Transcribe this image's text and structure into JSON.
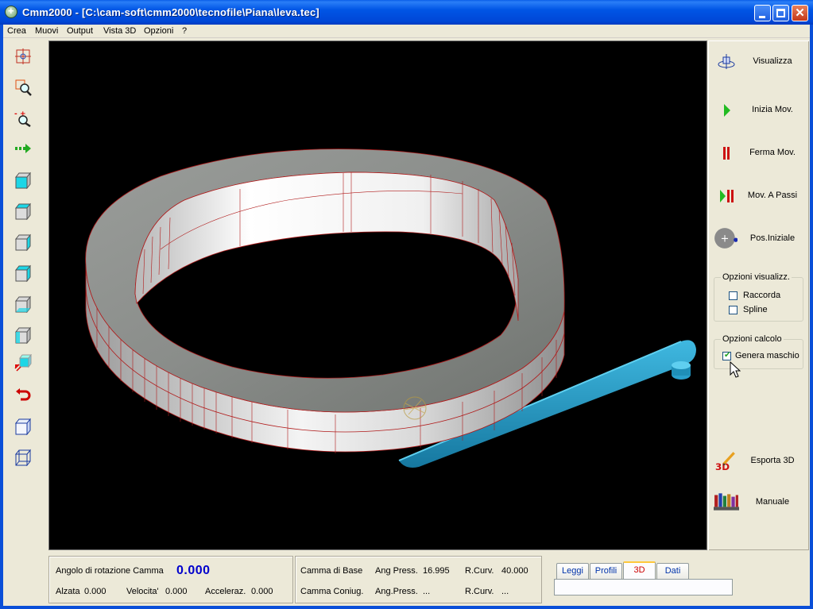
{
  "window": {
    "title": "Cmm2000 - [C:\\cam-soft\\cmm2000\\tecnofile\\Piana\\leva.tec]"
  },
  "menu": [
    "Crea",
    "Muovi",
    "Output",
    "Vista 3D",
    "Opzioni",
    "?"
  ],
  "left_toolbar": [
    {
      "icon": "move-center-icon"
    },
    {
      "icon": "zoom-window-icon"
    },
    {
      "icon": "zoom-in-out-icon"
    },
    {
      "icon": "pan-arrow-icon"
    },
    {
      "icon": "view-front-cube-icon"
    },
    {
      "icon": "view-top-cube-icon"
    },
    {
      "icon": "view-side-cube-icon"
    },
    {
      "icon": "view-back-cube-icon"
    },
    {
      "icon": "view-bottom-cube-icon"
    },
    {
      "icon": "view-right-cube-icon"
    },
    {
      "icon": "view-iso-cube-icon"
    },
    {
      "icon": "undo-rotate-icon"
    },
    {
      "icon": "shaded-cube-icon"
    },
    {
      "icon": "wireframe-cube-icon"
    }
  ],
  "right_panel": {
    "buttons": {
      "visualizza": "Visualizza",
      "inizia": "Inizia Mov.",
      "ferma": "Ferma Mov.",
      "passi": "Mov. A Passi",
      "pos": "Pos.Iniziale",
      "esporta": "Esporta 3D",
      "manuale": "Manuale"
    },
    "esporta_icon_text": "3D",
    "opzioni_visualizz": {
      "legend": "Opzioni visualizz.",
      "raccorda": {
        "label": "Raccorda",
        "checked": false
      },
      "spline": {
        "label": "Spline",
        "checked": false
      }
    },
    "opzioni_calcolo": {
      "legend": "Opzioni calcolo",
      "genera": {
        "label": "Genera maschio",
        "checked": true
      }
    }
  },
  "status": {
    "angolo_label": "Angolo di rotazione Camma",
    "angolo_value": "0.000",
    "alzata_label": "Alzata",
    "alzata_value": "0.000",
    "velocita_label": "Velocita'",
    "velocita_value": "0.000",
    "acceleraz_label": "Acceleraz.",
    "acceleraz_value": "0.000",
    "camma_base": "Camma di Base",
    "camma_coniug": "Camma Coniug.",
    "ang_press_label": "Ang Press.",
    "ang_press_value": "16.995",
    "rcurv_label": "R.Curv.",
    "rcurv_value": "40.000",
    "ang_press2_label": "Ang.Press.",
    "ang_press2_value": "...",
    "rcurv2_label": "R.Curv.",
    "rcurv2_value": "..."
  },
  "tabs": [
    "Leggi",
    "Profili",
    "3D",
    "Dati"
  ],
  "active_tab": "3D",
  "colors": {
    "cam_top": "#8a8d8a",
    "cam_edge": "#c82020",
    "lever": "#1f8fb8",
    "viewport_bg": "#000000",
    "accent_value": "#0000cc"
  }
}
